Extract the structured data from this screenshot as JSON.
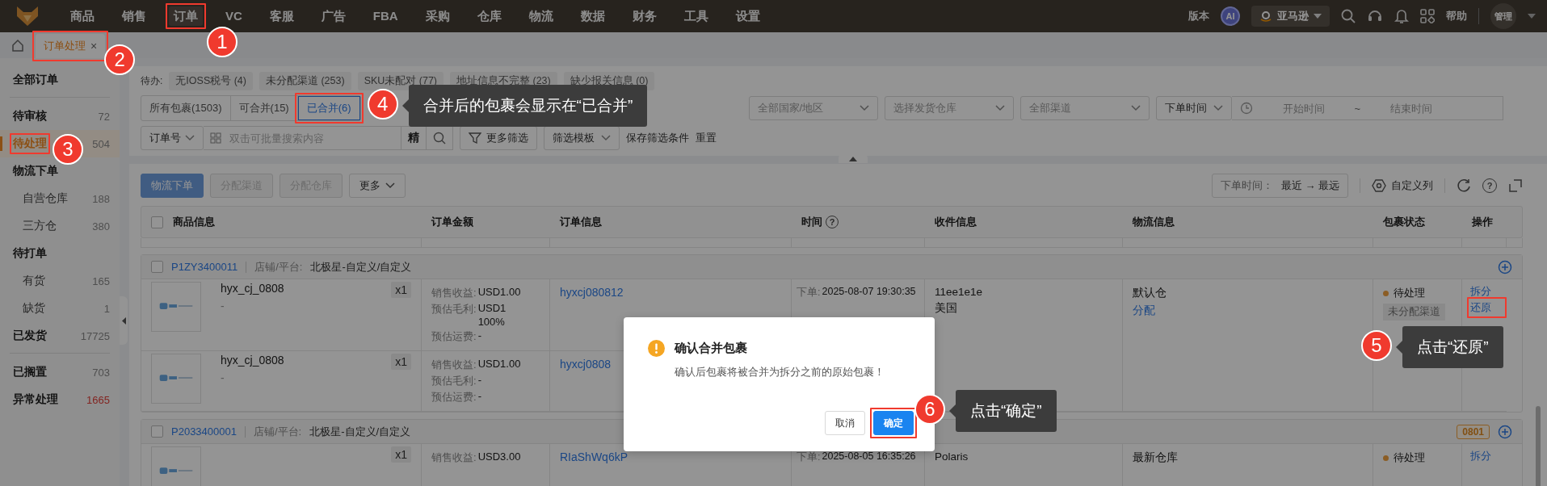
{
  "top_nav": {
    "items": [
      {
        "label": "商品",
        "selected": false
      },
      {
        "label": "销售",
        "selected": false
      },
      {
        "label": "订单",
        "selected": true
      },
      {
        "label": "VC",
        "selected": false
      },
      {
        "label": "客服",
        "selected": false
      },
      {
        "label": "广告",
        "selected": false
      },
      {
        "label": "FBA",
        "selected": false
      },
      {
        "label": "采购",
        "selected": false
      },
      {
        "label": "仓库",
        "selected": false
      },
      {
        "label": "物流",
        "selected": false
      },
      {
        "label": "数据",
        "selected": false
      },
      {
        "label": "财务",
        "selected": false
      },
      {
        "label": "工具",
        "selected": false
      },
      {
        "label": "设置",
        "selected": false
      }
    ],
    "version": "版本",
    "ai": "AI",
    "marketplace": "亚马逊",
    "help": "帮助",
    "user": "管理"
  },
  "tabs": [
    {
      "label": "订单处理",
      "selected": true,
      "close": "×"
    }
  ],
  "sidebar": {
    "groups": [
      [
        {
          "label": "全部订单",
          "selected": false,
          "alert": false
        }
      ],
      [
        {
          "label": "待审核",
          "count": "72",
          "selected": false,
          "alert": false
        },
        {
          "label": "待处理",
          "count": "504",
          "selected": true,
          "alert": false
        },
        {
          "label": "物流下单",
          "selected": false,
          "alert": false,
          "children": [
            {
              "label": "自营仓库",
              "count": "188",
              "selected": false,
              "alert": false
            },
            {
              "label": "三方仓",
              "count": "380",
              "selected": false,
              "alert": false
            }
          ]
        },
        {
          "label": "待打单",
          "selected": false,
          "alert": false,
          "children": [
            {
              "label": "有货",
              "count": "165",
              "selected": false,
              "alert": false
            },
            {
              "label": "缺货",
              "count": "1",
              "selected": false,
              "alert": false
            }
          ]
        },
        {
          "label": "已发货",
          "count": "17725",
          "selected": false,
          "alert": false
        }
      ],
      [
        {
          "label": "已搁置",
          "count": "703",
          "selected": false,
          "alert": false
        },
        {
          "label": "异常处理",
          "count": "1665",
          "selected": false,
          "alert": true
        }
      ]
    ]
  },
  "pending": {
    "label": "待办:",
    "chips": [
      "无IOSS税号 (4)",
      "未分配渠道 (253)",
      "SKU未配对 (77)",
      "地址信息不完整 (23)",
      "缺少报关信息 (0)"
    ]
  },
  "filters": {
    "package_tabs": [
      {
        "label": "所有包裹(1503)",
        "selected": false
      },
      {
        "label": "可合并(15)",
        "selected": false
      },
      {
        "label": "已合并(6)",
        "selected": true
      }
    ],
    "dropdowns": [
      {
        "placeholder": "全部国家/地区"
      },
      {
        "placeholder": "选择发货仓库"
      },
      {
        "placeholder": "全部渠道"
      }
    ],
    "date_range": {
      "type": "下单时间",
      "start_placeholder": "开始时间",
      "separator": "~",
      "end_placeholder": "结束时间"
    },
    "search": {
      "type": "订单号",
      "placeholder": "双击可批量搜索内容",
      "exact": "精"
    },
    "more_filters": "更多筛选",
    "template": "筛选模板",
    "save": "保存筛选条件",
    "reset": "重置"
  },
  "toolbar": {
    "buttons": [
      {
        "label": "物流下单",
        "kind": "primary",
        "disabled": true
      },
      {
        "label": "分配渠道",
        "kind": "default",
        "disabled": true
      },
      {
        "label": "分配仓库",
        "kind": "default",
        "disabled": true
      },
      {
        "label": "更多",
        "kind": "dropdown",
        "disabled": false
      }
    ],
    "sort": {
      "label": "下单时间：",
      "value": "最近 → 最远"
    },
    "columns_button": "自定义列",
    "help_mark": "?"
  },
  "table": {
    "checked": false,
    "columns": [
      {
        "label": "商品信息"
      },
      {
        "label": "订单金额"
      },
      {
        "label": "订单信息"
      },
      {
        "label": "时间",
        "hint": "?"
      },
      {
        "label": "收件信息"
      },
      {
        "label": "物流信息"
      },
      {
        "label": "包裹状态"
      },
      {
        "label": "操作"
      }
    ],
    "packages": [
      {
        "id": "P1ZY3400011",
        "checked": false,
        "shop_label": "店铺/平台:",
        "shop": "北极星-自定义/自定义",
        "time_label": "下单:",
        "time": "2025-08-07 19:30:35",
        "recipient": [
          "11ee1e1e",
          "美国"
        ],
        "warehouse": "默认仓",
        "assign": "分配",
        "status": "待处理",
        "status_tag": "未分配渠道",
        "actions": [
          "拆分",
          "还原"
        ],
        "items": [
          {
            "name": "hyx_cj_0808",
            "sku": "-",
            "qty": "x1",
            "order_no": "hyxcj080812",
            "amounts": [
              {
                "label": "销售收益:",
                "values": [
                  "USD1.00"
                ]
              },
              {
                "label": "预估毛利:",
                "values": [
                  "USD1",
                  "100%"
                ]
              },
              {
                "label": "预估运费:",
                "values": [
                  "-"
                ]
              }
            ]
          },
          {
            "name": "hyx_cj_0808",
            "sku": "-",
            "qty": "x1",
            "order_no": "hyxcj0808",
            "amounts": [
              {
                "label": "销售收益:",
                "values": [
                  "USD1.00"
                ]
              },
              {
                "label": "预估毛利:",
                "values": [
                  "-"
                ]
              },
              {
                "label": "预估运费:",
                "values": [
                  "-"
                ]
              }
            ]
          }
        ]
      },
      {
        "id": "P2033400001",
        "checked": false,
        "shop_label": "店铺/平台:",
        "shop": "北极星-自定义/自定义",
        "tag": "0801",
        "time_label": "下单:",
        "time": "2025-08-05 16:35:26",
        "recipient": [
          "Polaris"
        ],
        "warehouse": "最新仓库",
        "status": "待处理",
        "actions": [
          "拆分"
        ],
        "items": [
          {
            "qty": "x1",
            "order_no": "RIaShWq6kP",
            "amounts": [
              {
                "label": "销售收益:",
                "values": [
                  "USD3.00"
                ]
              }
            ]
          }
        ]
      }
    ]
  },
  "dialog": {
    "title": "确认合并包裹",
    "message": "确认后包裹将被合并为拆分之前的原始包裹！",
    "buttons": [
      {
        "label": "取消",
        "kind": "default"
      },
      {
        "label": "确定",
        "kind": "primary"
      }
    ]
  },
  "annotations": [
    {
      "number": "1"
    },
    {
      "number": "2"
    },
    {
      "number": "3"
    },
    {
      "number": "4",
      "note": "合并后的包裹会显示在“已合并”"
    },
    {
      "number": "5",
      "note": "点击“还原”"
    },
    {
      "number": "6",
      "note": "点击“确定”"
    }
  ]
}
